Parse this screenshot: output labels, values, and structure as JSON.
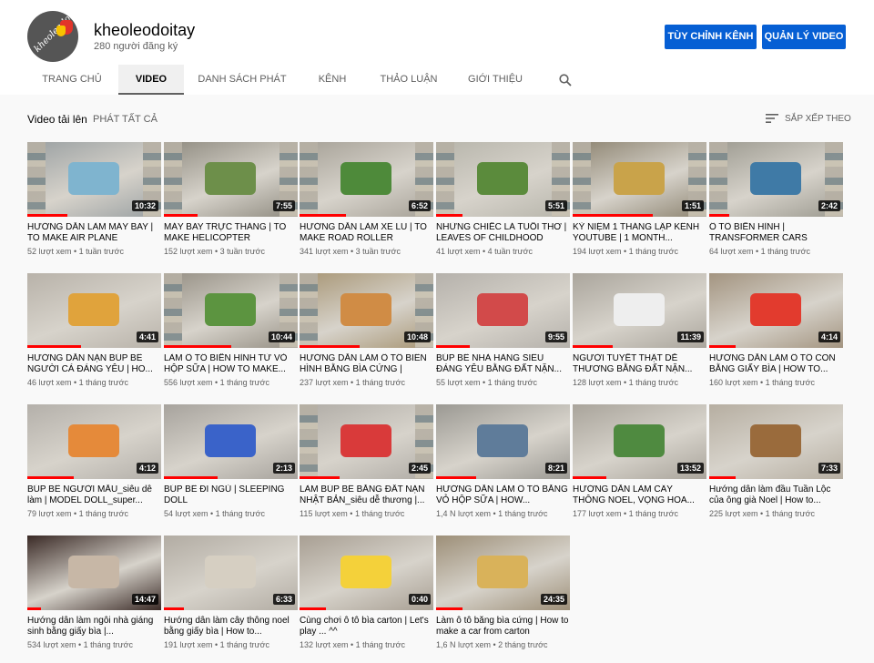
{
  "channel": {
    "avatar_text": "kheoleodoitay",
    "name": "kheoleodoitay",
    "subscribers": "280 người đăng ký",
    "customize_label": "TÙY CHỈNH KÊNH",
    "manage_label": "QUẢN LÝ VIDEO"
  },
  "tabs": [
    {
      "label": "TRANG CHỦ",
      "active": false
    },
    {
      "label": "VIDEO",
      "active": true
    },
    {
      "label": "DANH SÁCH PHÁT",
      "active": false
    },
    {
      "label": "KÊNH",
      "active": false
    },
    {
      "label": "THẢO LUẬN",
      "active": false
    },
    {
      "label": "GIỚI THIỆU",
      "active": false
    }
  ],
  "section": {
    "title": "Video tải lên",
    "play_all": "PHÁT TẤT CẢ",
    "sort_label": "SẮP XẾP THEO"
  },
  "videos": [
    {
      "title": "HƯỚNG DẪN LÀM MÁY BAY | TO MAKE AIR PLANE",
      "views": "52 lượt xem",
      "age": "1 tuần trước",
      "duration": "10:32",
      "progress": 0.3,
      "bg": "#9aa0a2",
      "accent": "#7fb4cf"
    },
    {
      "title": "MÁY BAY TRỰC THĂNG | TO MAKE HELICOPTER",
      "views": "152 lượt xem",
      "age": "3 tuần trước",
      "duration": "7:55",
      "progress": 0.25,
      "bg": "#8f8b80",
      "accent": "#6d8f4a"
    },
    {
      "title": "HƯỚNG DẪN LÀM XE LU | TO MAKE ROAD ROLLER",
      "views": "341 lượt xem",
      "age": "3 tuần trước",
      "duration": "6:52",
      "progress": 0.35,
      "bg": "#a6a197",
      "accent": "#4e8a3a"
    },
    {
      "title": "NHỮNG CHIẾC LÁ TUỔI THƠ | LEAVES OF CHILDHOOD",
      "views": "41 lượt xem",
      "age": "4 tuần trước",
      "duration": "5:51",
      "progress": 0.2,
      "bg": "#b7b5ab",
      "accent": "#5b8b3c"
    },
    {
      "title": "KỶ NIỆM 1 THÁNG LẬP KÊNH YOUTUBE | 1 MONTH...",
      "views": "194 lượt xem",
      "age": "1 tháng trước",
      "duration": "1:51",
      "progress": 0.6,
      "bg": "#8d8471",
      "accent": "#c9a34a"
    },
    {
      "title": "Ô TÔ BIẾN HÌNH | TRANSFORMER CARS",
      "views": "64 lượt xem",
      "age": "1 tháng trước",
      "duration": "2:42",
      "progress": 0.15,
      "bg": "#9c9a90",
      "accent": "#3f7aa6"
    },
    {
      "title": "HƯỚNG DẪN NẶN BÚP BÊ NGƯỜI CÁ ĐÁNG YÊU | HO...",
      "views": "46 lượt xem",
      "age": "1 tháng trước",
      "duration": "4:41",
      "progress": 0.4,
      "bg": "#b8b2a9",
      "accent": "#e0a33c"
    },
    {
      "title": "LÀM Ô TÔ BIẾN HÌNH TỪ VỎ HỘP SỮA | HOW TO MAKE...",
      "views": "556 lượt xem",
      "age": "1 tháng trước",
      "duration": "10:44",
      "progress": 0.5,
      "bg": "#958f84",
      "accent": "#5c9440"
    },
    {
      "title": "HƯỚNG DẪN LÀM Ô TÔ BIÊN HÌNH BẰNG BÌA CỨNG | HOW...",
      "views": "237 lượt xem",
      "age": "1 tháng trước",
      "duration": "10:48",
      "progress": 0.45,
      "bg": "#a79574",
      "accent": "#d08c45"
    },
    {
      "title": "BÚP BÊ NHÀ HÀNG SIÊU ĐÁNG YÊU BẰNG ĐẤT NẶN...",
      "views": "55 lượt xem",
      "age": "1 tháng trước",
      "duration": "9:55",
      "progress": 0.25,
      "bg": "#b5b1ab",
      "accent": "#d24a4a"
    },
    {
      "title": "NGƯỜI TUYẾT THẬT DỄ THƯƠNG BẰNG ĐẤT NẶN...",
      "views": "128 lượt xem",
      "age": "1 tháng trước",
      "duration": "11:39",
      "progress": 0.3,
      "bg": "#aaa59c",
      "accent": "#eeeeee"
    },
    {
      "title": "HƯỚNG DẪN LÀM Ô TÔ CON BẰNG GIẤY BÌA | HOW TO...",
      "views": "160 lượt xem",
      "age": "1 tháng trước",
      "duration": "4:14",
      "progress": 0.2,
      "bg": "#a39480",
      "accent": "#e23b2e"
    },
    {
      "title": "BÚP BÊ NGƯỜI MẪU_siêu dễ làm | MODEL DOLL_super...",
      "views": "79 lượt xem",
      "age": "1 tháng trước",
      "duration": "4:12",
      "progress": 0.35,
      "bg": "#b4b0aa",
      "accent": "#e58a3a"
    },
    {
      "title": "BÚP BÊ ĐI NGỦ | SLEEPING DOLL",
      "views": "54 lượt xem",
      "age": "1 tháng trước",
      "duration": "2:13",
      "progress": 0.4,
      "bg": "#a7a39d",
      "accent": "#3a63c9"
    },
    {
      "title": "LÀM BÚP BÊ BẰNG ĐẤT NẶN NHẬT BẢN_siêu dễ thương |...",
      "views": "115 lượt xem",
      "age": "1 tháng trước",
      "duration": "2:45",
      "progress": 0.3,
      "bg": "#b0aca6",
      "accent": "#d93a3a"
    },
    {
      "title": "HƯỚNG DẪN LÀM Ô TÔ BẰNG VỎ HỘP SỮA | HOW...",
      "views": "1,4 N lượt xem",
      "age": "1 tháng trước",
      "duration": "8:21",
      "progress": 0.3,
      "bg": "#9b9993",
      "accent": "#5f7c9a"
    },
    {
      "title": "HƯỚNG DẪN LÀM CÂY THÔNG NOEL, VỌNG HOA...",
      "views": "177 lượt xem",
      "age": "1 tháng trước",
      "duration": "13:52",
      "progress": 0.25,
      "bg": "#a9a49b",
      "accent": "#4f8a40"
    },
    {
      "title": "Hướng dẫn làm đầu Tuần Lộc của ông già Noel | How to...",
      "views": "225 lượt xem",
      "age": "1 tháng trước",
      "duration": "7:33",
      "progress": 0.2,
      "bg": "#b6aea1",
      "accent": "#9a6b3c"
    },
    {
      "title": "Hướng dẫn làm ngôi nhà giáng sinh bằng giấy bìa |...",
      "views": "534 lượt xem",
      "age": "1 tháng trước",
      "duration": "14:47",
      "progress": 0.1,
      "bg": "#3a2a26",
      "accent": "#c7b7a6"
    },
    {
      "title": "Hướng dẫn làm cây thông noel bằng giấy bìa | How to...",
      "views": "191 lượt xem",
      "age": "1 tháng trước",
      "duration": "6:33",
      "progress": 0.15,
      "bg": "#b2aca3",
      "accent": "#d6cfc2"
    },
    {
      "title": "Cùng chơi ô tô bìa carton | Let's play ... ^^",
      "views": "132 lượt xem",
      "age": "1 tháng trước",
      "duration": "0:40",
      "progress": 0.2,
      "bg": "#a89f93",
      "accent": "#f4d13a"
    },
    {
      "title": "Làm ô tô bằng bìa cứng | How to make a car from carton",
      "views": "1,6 N lượt xem",
      "age": "2 tháng trước",
      "duration": "24:35",
      "progress": 0.2,
      "bg": "#9d8f78",
      "accent": "#d9b25a"
    }
  ]
}
